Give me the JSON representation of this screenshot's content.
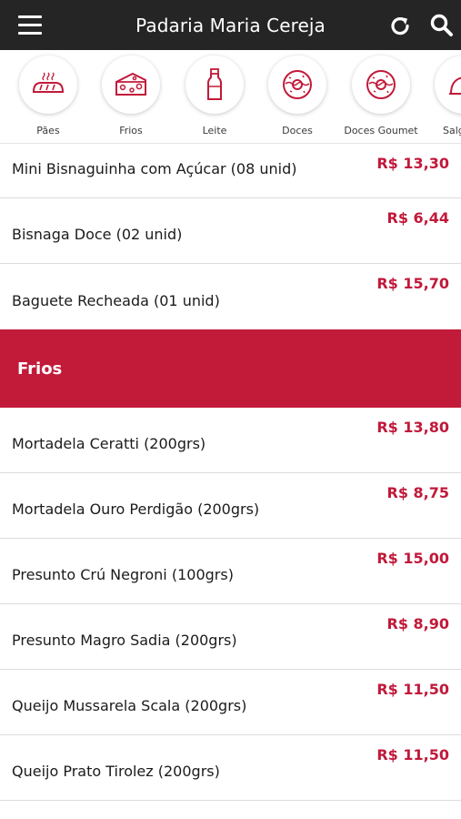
{
  "header": {
    "title": "Padaria Maria Cereja"
  },
  "categories": [
    {
      "label": "Pães",
      "icon": "bread-icon"
    },
    {
      "label": "Frios",
      "icon": "cheese-icon"
    },
    {
      "label": "Leite",
      "icon": "milk-bottle-icon"
    },
    {
      "label": "Doces",
      "icon": "donut-icon"
    },
    {
      "label": "Doces Goumet",
      "icon": "donut-icon"
    },
    {
      "label": "Salg",
      "icon": "savory-icon"
    }
  ],
  "products_paes": [
    {
      "name": "Mini Bisnaguinha com Açúcar (08 unid)",
      "price": "R$ 13,30"
    },
    {
      "name": "Bisnaga Doce (02 unid)",
      "price": "R$ 6,44"
    },
    {
      "name": "Baguete Recheada (01 unid)",
      "price": "R$ 15,70"
    }
  ],
  "section_frios": {
    "title": "Frios"
  },
  "products_frios": [
    {
      "name": "Mortadela Ceratti (200grs)",
      "price": "R$ 13,80"
    },
    {
      "name": "Mortadela Ouro Perdigão (200grs)",
      "price": "R$ 8,75"
    },
    {
      "name": "Presunto Crú Negroni (100grs)",
      "price": "R$ 15,00"
    },
    {
      "name": "Presunto Magro Sadia (200grs)",
      "price": "R$ 8,90"
    },
    {
      "name": "Queijo Mussarela Scala (200grs)",
      "price": "R$ 11,50"
    },
    {
      "name": "Queijo Prato Tirolez (200grs)",
      "price": "R$ 11,50"
    }
  ],
  "colors": {
    "topbar": "#252525",
    "accent": "#c21a39",
    "price": "#c1193a"
  }
}
